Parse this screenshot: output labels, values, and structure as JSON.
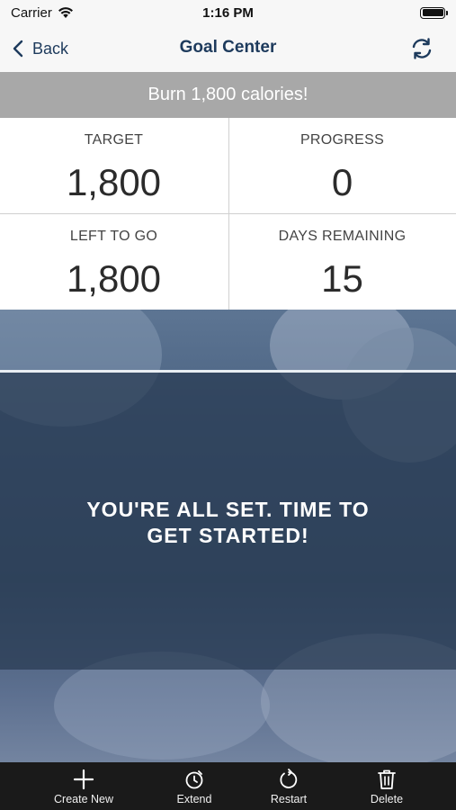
{
  "status_bar": {
    "carrier": "Carrier",
    "time": "1:16 PM",
    "icons": [
      "wifi-icon",
      "battery-icon"
    ]
  },
  "nav": {
    "back_label": "Back",
    "title": "Goal Center",
    "refresh_icon": "refresh-icon",
    "accent_color": "#1d3a5c"
  },
  "goal": {
    "banner": "Burn 1,800 calories!"
  },
  "stats": [
    {
      "label": "TARGET",
      "value": "1,800"
    },
    {
      "label": "PROGRESS",
      "value": "0"
    },
    {
      "label": "LEFT TO GO",
      "value": "1,800"
    },
    {
      "label": "DAYS REMAINING",
      "value": "15"
    }
  ],
  "hero": {
    "message_line1": "YOU'RE ALL SET. TIME TO",
    "message_line2": "GET STARTED!"
  },
  "tab_bar": {
    "items": [
      {
        "label": "Create New",
        "icon": "plus-icon"
      },
      {
        "label": "Extend",
        "icon": "clock-icon"
      },
      {
        "label": "Restart",
        "icon": "restart-icon"
      },
      {
        "label": "Delete",
        "icon": "trash-icon"
      }
    ]
  }
}
